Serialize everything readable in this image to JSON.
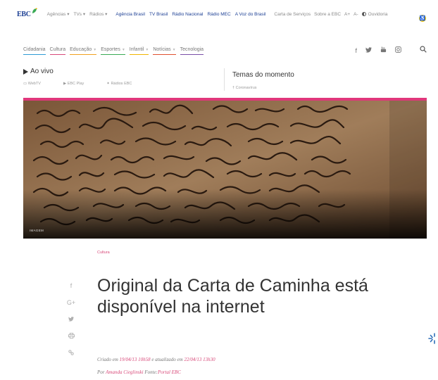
{
  "topbar": {
    "logo_text": "EBC",
    "menu": [
      "Agências ▾",
      "TVs ▾",
      "Rádios ▾"
    ],
    "links": [
      "Agência Brasil",
      "TV Brasil",
      "Rádio Nacional",
      "Rádio MEC",
      "A Voz do Brasil"
    ],
    "right": [
      "Carta de Serviços",
      "Sobre a EBC",
      "A+",
      "A-"
    ],
    "ouvidoria": "Ouvidoria"
  },
  "nav": {
    "categories": [
      {
        "label": "Cidadania",
        "color": "#2e9bd6"
      },
      {
        "label": "Cultura",
        "color": "#d84a7a"
      },
      {
        "label": "Educação",
        "color": "#f0a020"
      },
      {
        "label": "Esportes",
        "color": "#3aaa55"
      },
      {
        "label": "Infantil",
        "color": "#f0b400"
      },
      {
        "label": "Notícias",
        "color": "#e05030"
      },
      {
        "label": "Tecnologia",
        "color": "#7a4fa8"
      }
    ]
  },
  "live": {
    "title": "Ao vivo",
    "links": [
      "WebTV",
      "EBC Play",
      "Rádios EBC"
    ]
  },
  "temas": {
    "title": "Temas do momento",
    "item": "Coronavírus"
  },
  "hero": {
    "label": "IMAGEM"
  },
  "article": {
    "section": "Cultura",
    "title": "Original da Carta de Caminha está disponível na internet",
    "meta_created_prefix": "Criado em",
    "created": "19/04/13 10h58",
    "meta_updated_prefix": "e atualizado em",
    "updated": "22/04/13 13h30",
    "by_prefix": "Por",
    "author": "Amanda Cieglinski",
    "source_prefix": "Fonte:",
    "source": "Portal EBC"
  },
  "colors": {
    "brand_blue": "#1c3f94",
    "accent_pink": "#d84a7a",
    "hero_border": "#e0377b"
  }
}
